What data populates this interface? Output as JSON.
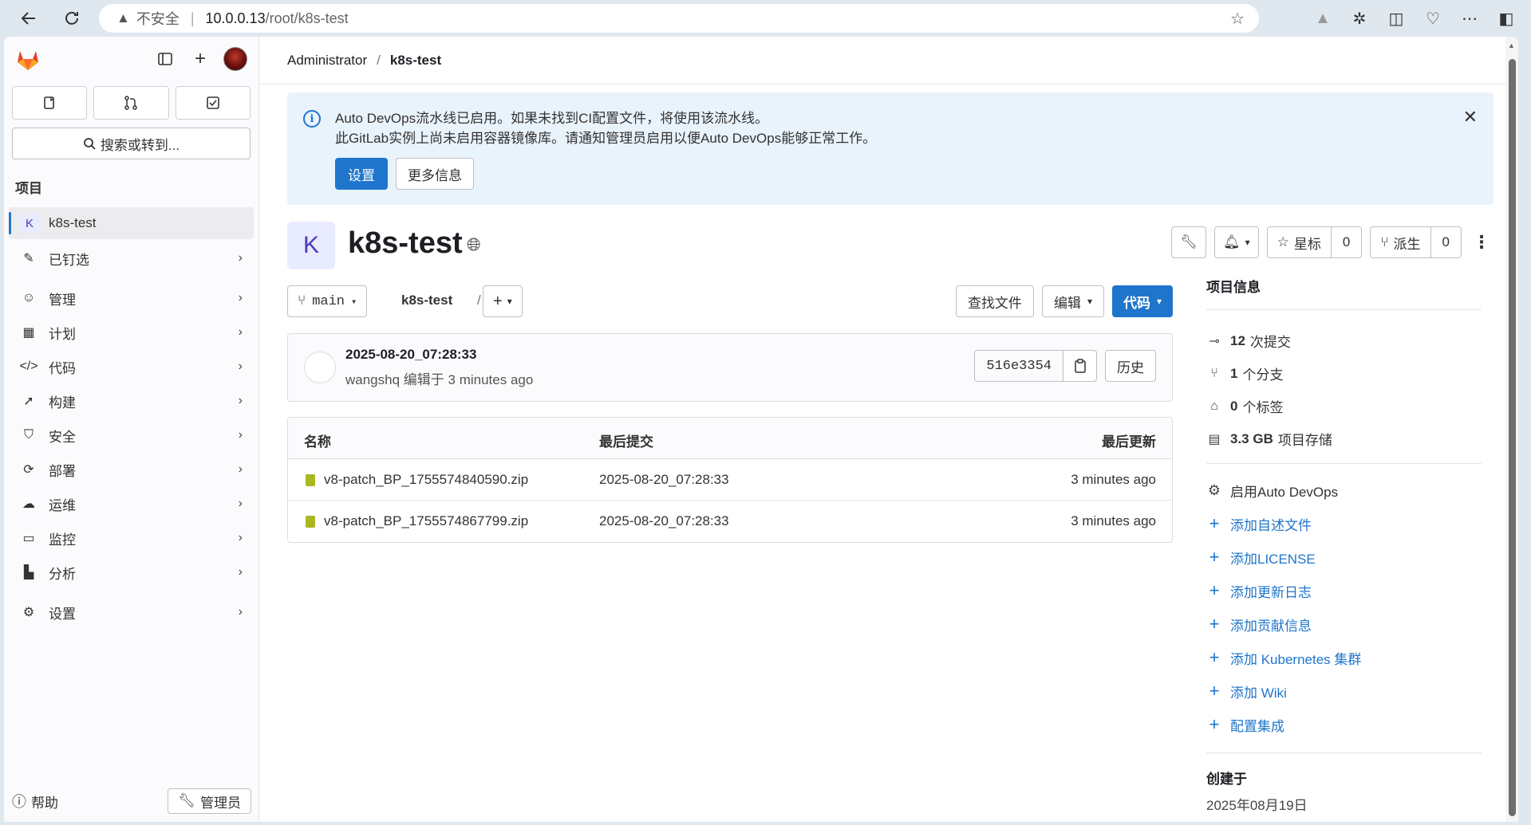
{
  "browser": {
    "insecure_label": "不安全",
    "url_host": "10.0.0.13",
    "url_path": "/root/k8s-test"
  },
  "sidebar": {
    "search_label": "搜索或转到...",
    "section_title": "项目",
    "project_initial": "K",
    "project_name": "k8s-test",
    "items": [
      {
        "label": "已钉选",
        "icon": "pin-icon"
      },
      {
        "label": "管理",
        "icon": "users-icon"
      },
      {
        "label": "计划",
        "icon": "calendar-icon"
      },
      {
        "label": "代码",
        "icon": "code-icon"
      },
      {
        "label": "构建",
        "icon": "rocket-icon"
      },
      {
        "label": "安全",
        "icon": "shield-icon"
      },
      {
        "label": "部署",
        "icon": "deploy-icon"
      },
      {
        "label": "运维",
        "icon": "cloud-icon"
      },
      {
        "label": "监控",
        "icon": "monitor-icon"
      },
      {
        "label": "分析",
        "icon": "chart-icon"
      },
      {
        "label": "设置",
        "icon": "gear-icon"
      }
    ],
    "help_label": "帮助",
    "admin_label": "管理员"
  },
  "breadcrumb": {
    "parent": "Administrator",
    "current": "k8s-test"
  },
  "alert": {
    "line1": "Auto DevOps流水线已启用。如果未找到CI配置文件，将使用该流水线。",
    "line2": "此GitLab实例上尚未启用容器镜像库。请通知管理员启用以便Auto DevOps能够正常工作。",
    "primary_btn": "设置",
    "secondary_btn": "更多信息"
  },
  "project": {
    "initial": "K",
    "title": "k8s-test",
    "star_label": "星标",
    "star_count": "0",
    "fork_label": "派生",
    "fork_count": "0"
  },
  "toolbar": {
    "branch": "main",
    "path": "k8s-test",
    "path_sep": "/",
    "find_file": "查找文件",
    "edit": "编辑",
    "code": "代码"
  },
  "commit": {
    "title": "2025-08-20_07:28:33",
    "author": "wangshq",
    "meta_suffix": "编辑于 3 minutes ago",
    "sha": "516e3354",
    "history": "历史"
  },
  "files": {
    "headers": {
      "name": "名称",
      "commit": "最后提交",
      "updated": "最后更新"
    },
    "rows": [
      {
        "name": "v8-patch_BP_1755574840590.zip",
        "commit": "2025-08-20_07:28:33",
        "updated": "3 minutes ago"
      },
      {
        "name": "v8-patch_BP_1755574867799.zip",
        "commit": "2025-08-20_07:28:33",
        "updated": "3 minutes ago"
      }
    ]
  },
  "project_info": {
    "title": "项目信息",
    "commits_count": "12",
    "commits_label": "次提交",
    "branches_count": "1",
    "branches_label": "个分支",
    "tags_count": "0",
    "tags_label": "个标签",
    "storage_size": "3.3 GB",
    "storage_label": "项目存储",
    "auto_devops": "启用Auto DevOps",
    "links": [
      "添加自述文件",
      "添加LICENSE",
      "添加更新日志",
      "添加贡献信息",
      "添加 Kubernetes 集群",
      "添加 Wiki",
      "配置集成"
    ],
    "created_title": "创建于",
    "created_date": "2025年08月19日"
  },
  "colors": {
    "accent": "#1f75cb",
    "alert_bg": "#e9f3fc",
    "project_avatar_bg": "#e9ebff"
  }
}
